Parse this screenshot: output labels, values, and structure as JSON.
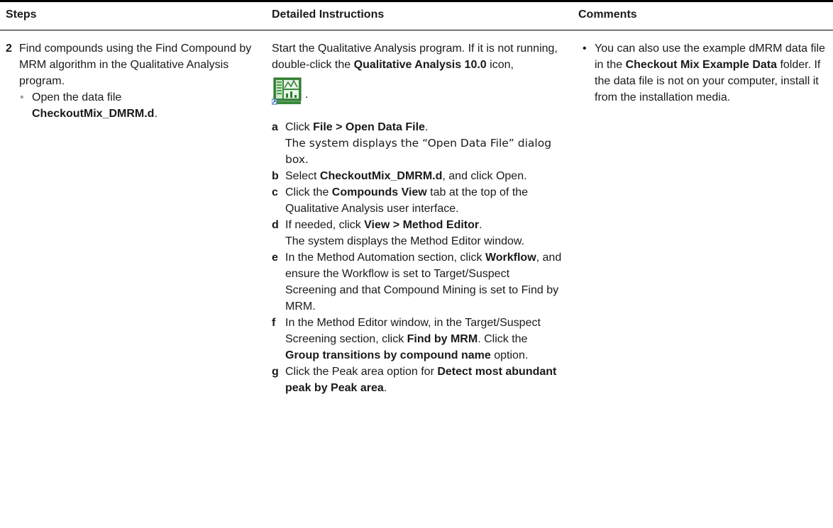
{
  "headers": {
    "steps": "Steps",
    "instructions": "Detailed Instructions",
    "comments": "Comments"
  },
  "step": {
    "number": "2",
    "text": "Find compounds using the Find Compound by MRM algorithm in the Qualitative Analysis program.",
    "bullet_text": "Open the data file",
    "bullet_file": "CheckoutMix_DMRM.d",
    "bullet_end": "."
  },
  "instructions": {
    "intro_1": "Start the Qualitative Analysis program. If it is not running, double-click the ",
    "intro_bold": "Qualitative Analysis 10.0",
    "intro_2": " icon,",
    "icon": "qualitative-analysis-app-icon",
    "icon_end": ".",
    "items": [
      {
        "letter": "a",
        "t1": "Click ",
        "b1": "File > Open Data File",
        "t2": ".",
        "line2": "The system displays the “Open Data File” dialog box."
      },
      {
        "letter": "b",
        "t1": "Select ",
        "b1": "CheckoutMix_DMRM.d",
        "t2": ", and click Open."
      },
      {
        "letter": "c",
        "t1": " Click the ",
        "b1": "Compounds View",
        "t2": " tab at the top of the Qualitative Analysis user interface."
      },
      {
        "letter": "d",
        "t1": "If needed, click ",
        "b1": "View > Method Editor",
        "t2": ".",
        "line2": "The system displays the Method Editor window."
      },
      {
        "letter": "e",
        "t1": "In the Method Automation section, click ",
        "b1": "Workflow",
        "t2": ", and ensure the Workflow is set to Target/Suspect Screening and that Compound Mining is set to Find by MRM."
      },
      {
        "letter": "f",
        "t1": "In the Method Editor window, in the Target/Suspect Screening section, click ",
        "b1": "Find by MRM",
        "t2": ". Click the ",
        "b2": "Group transitions by compound name",
        "t3": " option."
      },
      {
        "letter": "g",
        "t1": "Click the Peak area option for ",
        "b1": "Detect most abundant peak by Peak area",
        "t2": "."
      }
    ]
  },
  "comments": {
    "bullet": "•",
    "t1": "You can also use the example dMRM data file in the ",
    "b1": "Checkout Mix Example Data",
    "t2": " folder. If the data file is not on your computer, install it from the installation media."
  }
}
